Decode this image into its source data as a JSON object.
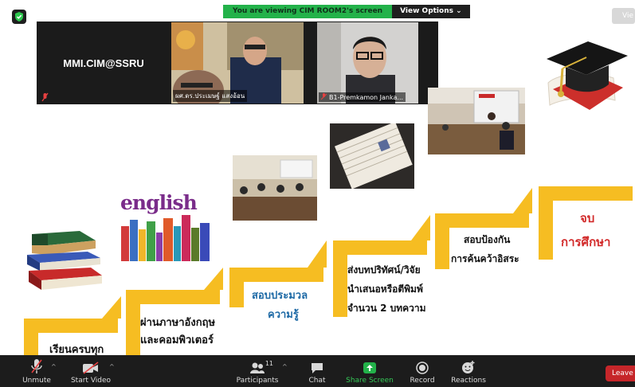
{
  "share_banner": {
    "message": "You are viewing CIM ROOM2's screen",
    "view_options": "View Options"
  },
  "view_label": "Vie",
  "gallery": {
    "tile1_name": "MMI.CIM@SSRU",
    "tile2_label": "ผศ.ดร.ประเมษฐ์ แสงอ้อน",
    "tile3_label": "B1-Premkamon Janka..."
  },
  "slide": {
    "english_word": "english",
    "steps": [
      {
        "line1": "เรียนครบทุก"
      },
      {
        "line1": "ผ่านภาษาอังกฤษ",
        "line2": "และคอมพิวเตอร์"
      },
      {
        "line1": "สอบประมวล",
        "line2": "ความรู้"
      },
      {
        "line1": "ส่งบทปริทัศน์/วิจัย",
        "line2": "นำเสนอหรือตีพิมพ์",
        "line3": "จำนวน 2 บทความ"
      },
      {
        "line1": "สอบป้องกัน",
        "line2": "การค้นคว้าอิสระ"
      },
      {
        "line1": "จบ",
        "line2": "การศึกษา"
      }
    ]
  },
  "toolbar": {
    "unmute": "Unmute",
    "start_video": "Start Video",
    "participants": "Participants",
    "participant_count": "11",
    "chat": "Chat",
    "share_screen": "Share Screen",
    "record": "Record",
    "reactions": "Reactions",
    "leave": "Leave"
  },
  "colors": {
    "step_yellow": "#f6bd22",
    "share_green": "#23b24a",
    "leave_red": "#c6262a",
    "toolbar_bg": "#1c1c1c"
  }
}
